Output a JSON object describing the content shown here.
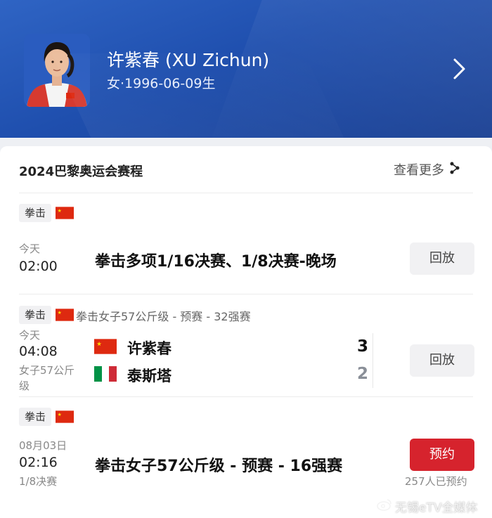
{
  "header": {
    "athlete_name": "许紫春 (XU Zichun)",
    "athlete_meta": "女·1996-06-09生",
    "avatar_icon": "athlete-portrait",
    "chevron_icon": "chevron-right-icon"
  },
  "schedule": {
    "title": "2024巴黎奥运会赛程",
    "see_more": "查看更多",
    "see_more_icon": "more-arrows-icon",
    "events": [
      {
        "sport": "拳击",
        "flag": "china-flag",
        "day": "今天",
        "time": "02:00",
        "title": "拳击多项1/16决赛、1/8决赛-晚场",
        "action": "回放"
      },
      {
        "sport": "拳击",
        "flag": "china-flag",
        "subtitle": "拳击女子57公斤级 - 预赛 - 32强赛",
        "day": "今天",
        "time": "04:08",
        "note": "女子57公斤级",
        "competitors": [
          {
            "name": "许紫春",
            "flag": "china-flag",
            "score": "3"
          },
          {
            "name": "泰斯塔",
            "flag": "italy-flag",
            "score": "2"
          }
        ],
        "action": "回放"
      },
      {
        "sport": "拳击",
        "flag": "china-flag",
        "day": "08月03日",
        "time": "02:16",
        "note": "1/8决赛",
        "title": "拳击女子57公斤级 - 预赛 - 16强赛",
        "action": "预约",
        "reserve_count": "257人已预约"
      }
    ]
  },
  "watermark": {
    "text": "无锡eTV全媒体",
    "icon": "weibo-icon"
  },
  "colors": {
    "header_blue": "#1f4fae",
    "reserve_red": "#d6232d",
    "china_red": "#de2910",
    "china_yellow": "#ffde00",
    "italy_green": "#009246",
    "italy_red": "#ce2b37"
  }
}
